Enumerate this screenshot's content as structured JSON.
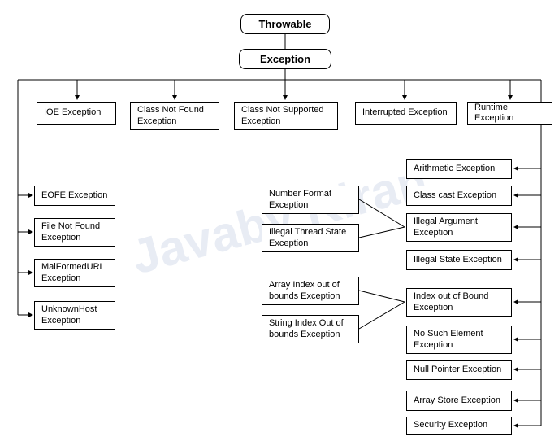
{
  "watermark": "Javaby Kiran",
  "hierarchy": {
    "root": "Throwable",
    "child": "Exception",
    "branches": {
      "ioe": {
        "label": "IOE Exception",
        "children": [
          "EOFE Exception",
          "File Not Found Exception",
          "MalFormedURL Exception",
          "UnknownHost Exception"
        ]
      },
      "cnf": {
        "label": "Class Not Found Exception"
      },
      "cns": {
        "label": "Class Not Supported Exception"
      },
      "interrupted": {
        "label": "Interrupted Exception"
      },
      "runtime": {
        "label": "Runtime Exception",
        "children": [
          "Arithmetic Exception",
          "Class cast Exception",
          "Illegal Argument Exception",
          "Illegal State Exception",
          "Index out of Bound Exception",
          "No Such Element Exception",
          "Null Pointer Exception",
          "Array Store Exception",
          "Security Exception"
        ],
        "illegal_argument_children": [
          "Number Format Exception",
          "Illegal Thread State Exception"
        ],
        "index_out_of_bound_children": [
          "Array Index out of bounds Exception",
          "String Index Out of bounds Exception"
        ]
      }
    }
  }
}
